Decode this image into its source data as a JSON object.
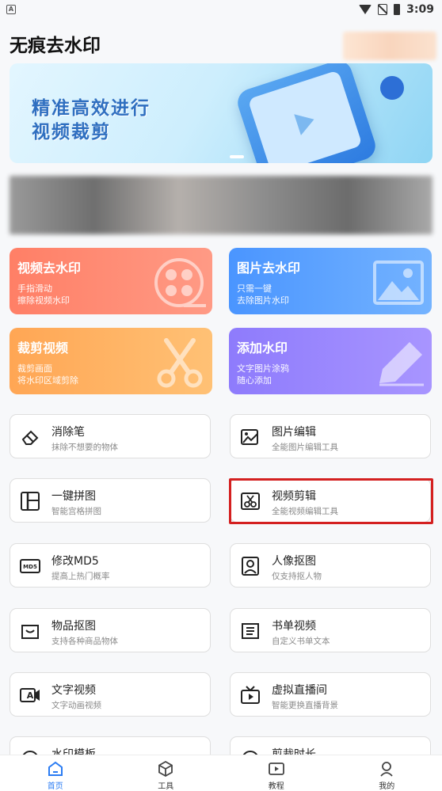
{
  "status_bar": {
    "time": "3:09",
    "notification_letter": "A"
  },
  "header": {
    "title": "无痕去水印"
  },
  "banner": {
    "line1": "精准高效进行",
    "line2": "视频裁剪"
  },
  "feature_cards": [
    {
      "title": "视频去水印",
      "line1": "手指滑动",
      "line2": "擦除视频水印",
      "icon": "film-reel-icon",
      "color": "#ff8670"
    },
    {
      "title": "图片去水印",
      "line1": "只需一键",
      "line2": "去除图片水印",
      "icon": "image-icon",
      "color": "#5aa0ff"
    },
    {
      "title": "裁剪视频",
      "line1": "裁剪画面",
      "line2": "将水印区域剪除",
      "icon": "scissors-icon",
      "color": "#ffb05f"
    },
    {
      "title": "添加水印",
      "line1": "文字图片涂鸦",
      "line2": "随心添加",
      "icon": "pencil-icon",
      "color": "#9784fd"
    }
  ],
  "tools": [
    {
      "title": "消除笔",
      "subtitle": "抹除不想要的物体",
      "icon": "eraser-icon"
    },
    {
      "title": "图片编辑",
      "subtitle": "全能图片编辑工具",
      "icon": "image-edit-icon"
    },
    {
      "title": "一键拼图",
      "subtitle": "智能宫格拼图",
      "icon": "collage-icon"
    },
    {
      "title": "视频剪辑",
      "subtitle": "全能视频编辑工具",
      "icon": "video-cut-icon"
    },
    {
      "title": "修改MD5",
      "subtitle": "提高上热门概率",
      "icon": "md5-icon",
      "badge": "MD5"
    },
    {
      "title": "人像抠图",
      "subtitle": "仅支持抠人物",
      "icon": "portrait-icon"
    },
    {
      "title": "物品抠图",
      "subtitle": "支持各种商品物体",
      "icon": "object-cutout-icon"
    },
    {
      "title": "书单视频",
      "subtitle": "自定义书单文本",
      "icon": "book-icon"
    },
    {
      "title": "文字视频",
      "subtitle": "文字动画视频",
      "icon": "text-video-icon",
      "badge": "A"
    },
    {
      "title": "虚拟直播间",
      "subtitle": "智能更换直播背景",
      "icon": "tv-icon"
    },
    {
      "title": "水印模板",
      "subtitle": "",
      "icon": "template-icon"
    },
    {
      "title": "剪裁时长",
      "subtitle": "",
      "icon": "clock-icon"
    }
  ],
  "bottom_nav": [
    {
      "label": "首页",
      "icon": "home-icon",
      "active": true
    },
    {
      "label": "工具",
      "icon": "cube-icon",
      "active": false
    },
    {
      "label": "教程",
      "icon": "play-icon",
      "active": false
    },
    {
      "label": "我的",
      "icon": "user-icon",
      "active": false
    }
  ],
  "colors": {
    "accent": "#2b7cf3",
    "highlight": "#d42020"
  }
}
